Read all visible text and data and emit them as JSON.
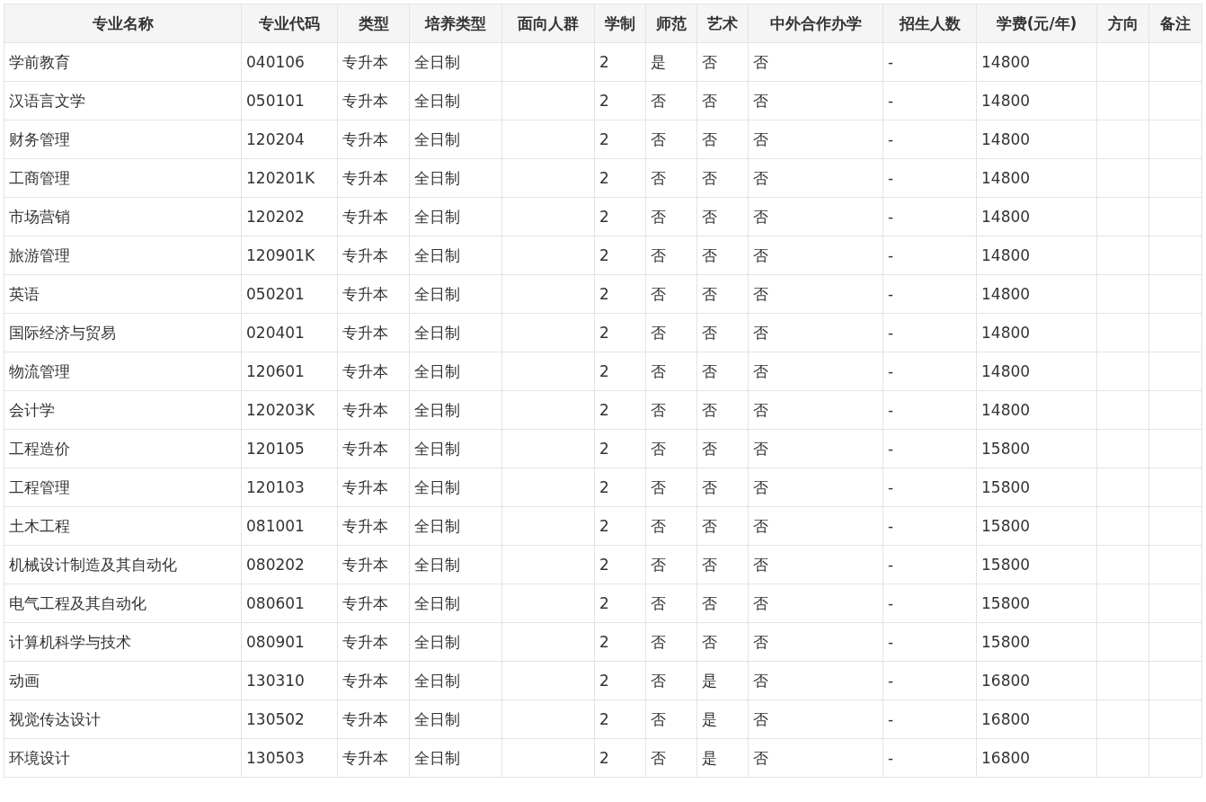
{
  "table": {
    "columns": [
      "专业名称",
      "专业代码",
      "类型",
      "培养类型",
      "面向人群",
      "学制",
      "师范",
      "艺术",
      "中外合作办学",
      "招生人数",
      "学费(元/年)",
      "方向",
      "备注"
    ],
    "rows": [
      [
        "学前教育",
        "040106",
        "专升本",
        "全日制",
        null,
        "2",
        "是",
        "否",
        "否",
        "-",
        "14800",
        null,
        null
      ],
      [
        "汉语言文学",
        "050101",
        "专升本",
        "全日制",
        null,
        "2",
        "否",
        "否",
        "否",
        "-",
        "14800",
        null,
        null
      ],
      [
        "财务管理",
        "120204",
        "专升本",
        "全日制",
        null,
        "2",
        "否",
        "否",
        "否",
        "-",
        "14800",
        null,
        null
      ],
      [
        "工商管理",
        "120201K",
        "专升本",
        "全日制",
        null,
        "2",
        "否",
        "否",
        "否",
        "-",
        "14800",
        null,
        null
      ],
      [
        "市场营销",
        "120202",
        "专升本",
        "全日制",
        null,
        "2",
        "否",
        "否",
        "否",
        "-",
        "14800",
        null,
        null
      ],
      [
        "旅游管理",
        "120901K",
        "专升本",
        "全日制",
        null,
        "2",
        "否",
        "否",
        "否",
        "-",
        "14800",
        null,
        null
      ],
      [
        "英语",
        "050201",
        "专升本",
        "全日制",
        null,
        "2",
        "否",
        "否",
        "否",
        "-",
        "14800",
        null,
        null
      ],
      [
        "国际经济与贸易",
        "020401",
        "专升本",
        "全日制",
        null,
        "2",
        "否",
        "否",
        "否",
        "-",
        "14800",
        null,
        null
      ],
      [
        "物流管理",
        "120601",
        "专升本",
        "全日制",
        null,
        "2",
        "否",
        "否",
        "否",
        "-",
        "14800",
        null,
        null
      ],
      [
        "会计学",
        "120203K",
        "专升本",
        "全日制",
        null,
        "2",
        "否",
        "否",
        "否",
        "-",
        "14800",
        null,
        null
      ],
      [
        "工程造价",
        "120105",
        "专升本",
        "全日制",
        null,
        "2",
        "否",
        "否",
        "否",
        "-",
        "15800",
        null,
        null
      ],
      [
        "工程管理",
        "120103",
        "专升本",
        "全日制",
        null,
        "2",
        "否",
        "否",
        "否",
        "-",
        "15800",
        null,
        null
      ],
      [
        "土木工程",
        "081001",
        "专升本",
        "全日制",
        null,
        "2",
        "否",
        "否",
        "否",
        "-",
        "15800",
        null,
        null
      ],
      [
        "机械设计制造及其自动化",
        "080202",
        "专升本",
        "全日制",
        null,
        "2",
        "否",
        "否",
        "否",
        "-",
        "15800",
        null,
        null
      ],
      [
        "电气工程及其自动化",
        "080601",
        "专升本",
        "全日制",
        null,
        "2",
        "否",
        "否",
        "否",
        "-",
        "15800",
        null,
        null
      ],
      [
        "计算机科学与技术",
        "080901",
        "专升本",
        "全日制",
        null,
        "2",
        "否",
        "否",
        "否",
        "-",
        "15800",
        null,
        null
      ],
      [
        "动画",
        "130310",
        "专升本",
        "全日制",
        null,
        "2",
        "否",
        "是",
        "否",
        "-",
        "16800",
        null,
        null
      ],
      [
        "视觉传达设计",
        "130502",
        "专升本",
        "全日制",
        null,
        "2",
        "否",
        "是",
        "否",
        "-",
        "16800",
        null,
        null
      ],
      [
        "环境设计",
        "130503",
        "专升本",
        "全日制",
        null,
        "2",
        "否",
        "是",
        "否",
        "-",
        "16800",
        null,
        null
      ]
    ]
  }
}
